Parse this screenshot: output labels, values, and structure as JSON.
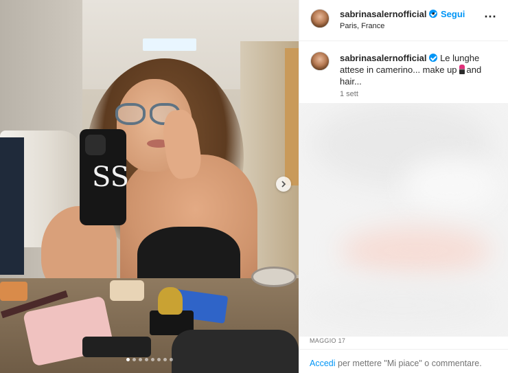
{
  "post": {
    "username": "sabrinasalernofficial",
    "follow_label": "Segui",
    "separator": "•",
    "location": "Paris, France",
    "more_icon": "⋯",
    "caption_text_1": "Le lunghe attese in camerino... make up",
    "caption_text_2": "and hair...",
    "time_ago": "1 sett",
    "date": "MAGGIO 17",
    "login_link": "Accedi",
    "login_rest": "per mettere \"Mi piace\" o commentare.",
    "phone_logo": "SS"
  },
  "carousel": {
    "dot_count": 8,
    "active_index": 0
  },
  "colors": {
    "accent": "#0095f6",
    "text": "#262626",
    "muted": "#737373"
  }
}
